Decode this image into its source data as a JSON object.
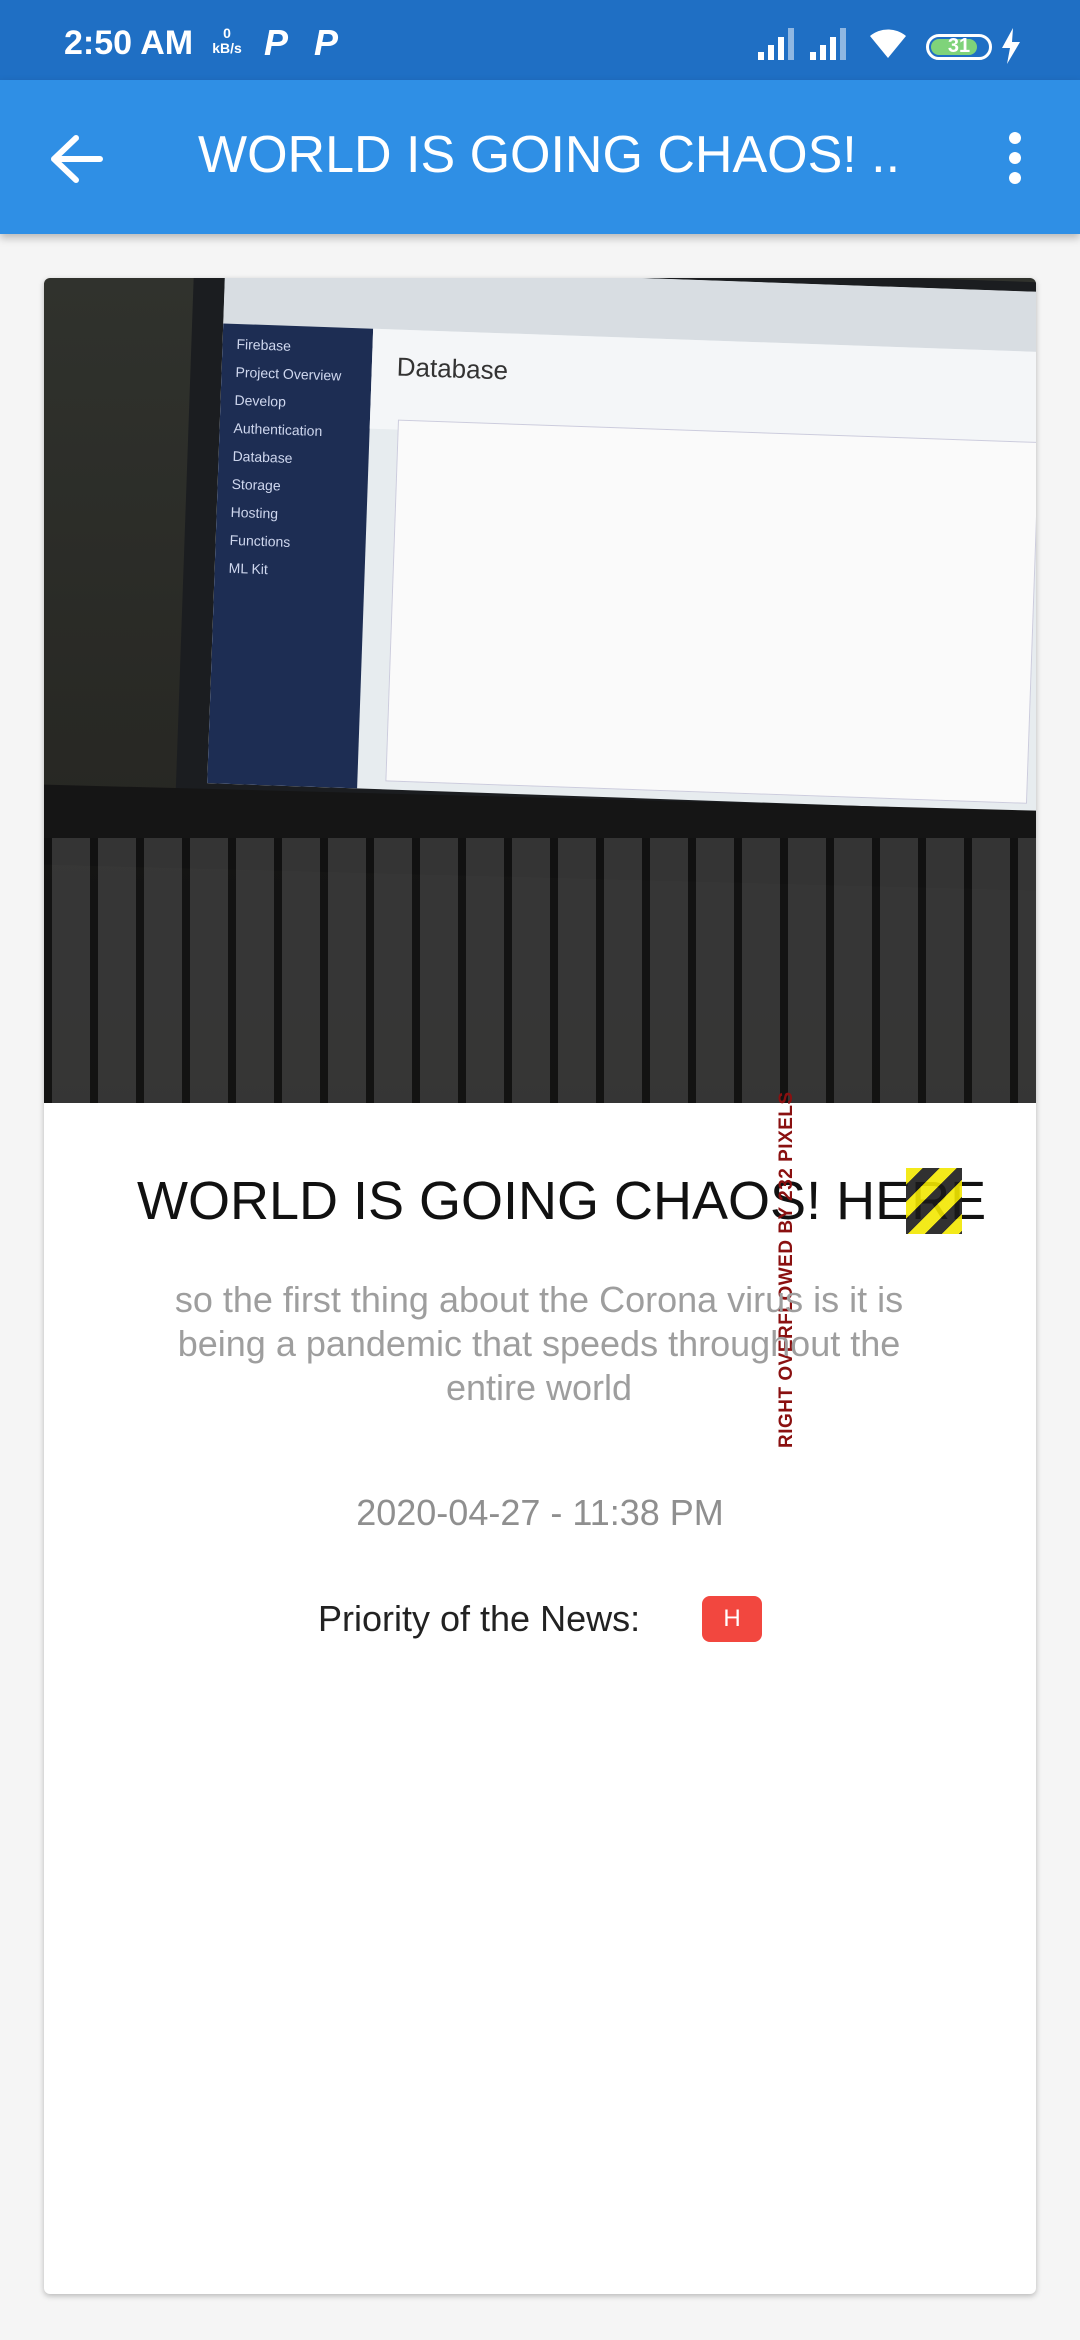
{
  "status_bar": {
    "time": "2:50 AM",
    "network_speed_value": "0",
    "network_speed_unit": "kB/s",
    "notification_icon_1": "P",
    "notification_icon_2": "P",
    "battery_level": "31",
    "icons": [
      "signal-icon",
      "signal-icon",
      "wifi-icon",
      "battery-icon",
      "charging-icon"
    ]
  },
  "app_bar": {
    "title": "WORLD IS GOING CHAOS! ...",
    "back_icon": "arrow-left-icon",
    "menu_icon": "more-vertical-icon",
    "color": "#2f8fe5"
  },
  "news": {
    "headline": "WORLD IS GOING CHAOS! HERE",
    "overflow_warning": "RIGHT OVERFLOWED BY 232 PIXELS",
    "description": "so the first thing about the Corona virus is it is being a pandemic that speeds throughout the entire world",
    "datetime": "2020-04-27 - 11:38 PM",
    "priority_label": "Priority of the News:",
    "priority_value": "H",
    "priority_color": "#f2473f"
  },
  "photo": {
    "console_title": "Database",
    "console_brand": "Firebase",
    "sidebar_items": [
      "Project Overview",
      "Develop",
      "Authentication",
      "Database",
      "Storage",
      "Hosting",
      "Functions",
      "ML Kit"
    ]
  }
}
